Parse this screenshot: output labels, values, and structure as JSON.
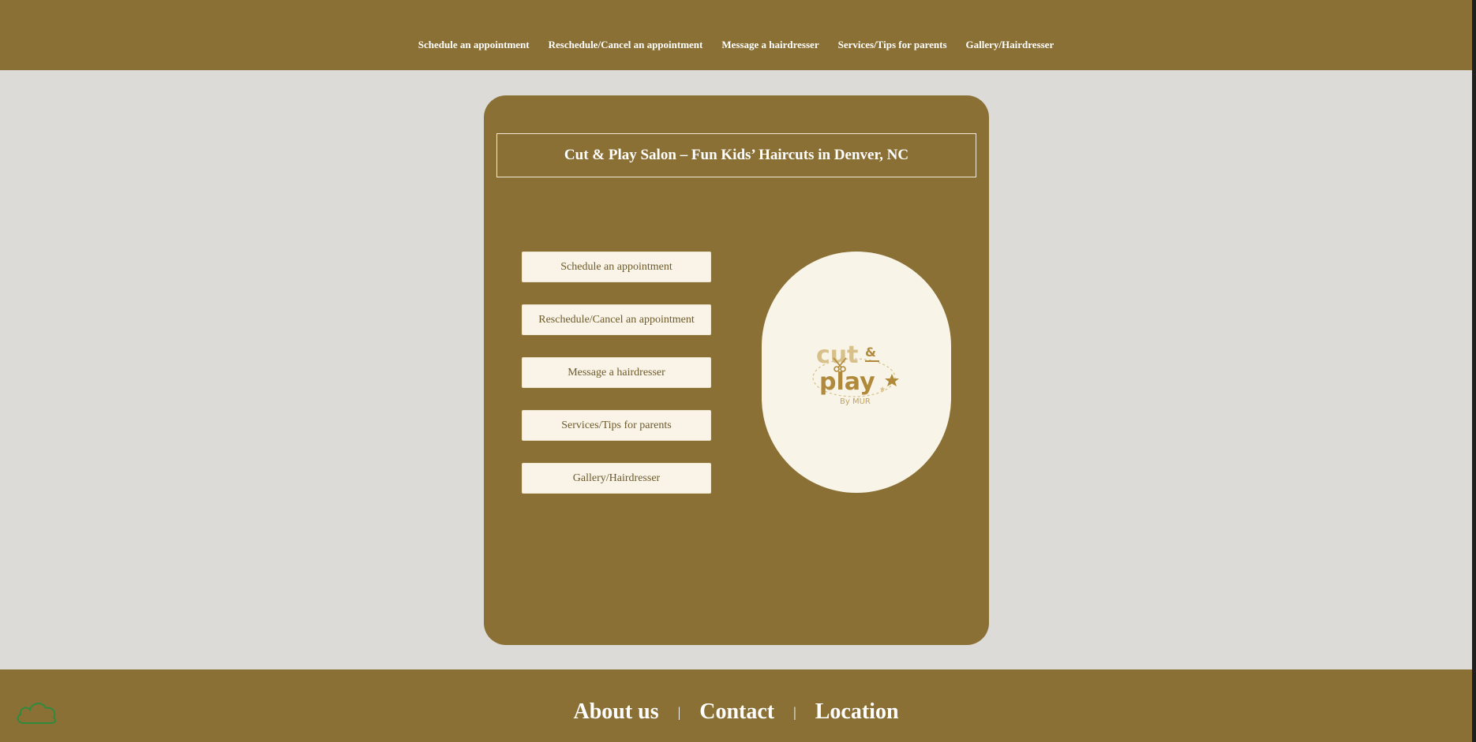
{
  "header": {
    "nav": [
      "Schedule an appointment",
      "Reschedule/Cancel an appointment",
      "Message a hairdresser",
      "Services/Tips for parents",
      "Gallery/Hairdresser"
    ]
  },
  "main": {
    "title": "Cut & Play Salon – Fun Kids’ Haircuts in Denver, NC",
    "buttons": [
      "Schedule an appointment",
      "Reschedule/Cancel an appointment",
      "Message a hairdresser",
      "Services/Tips for parents",
      "Gallery/Hairdresser"
    ],
    "logo": {
      "line1": "cut",
      "amp": "&",
      "line2": "play",
      "byline": "By MUR",
      "icon": "scissors-star-logo"
    }
  },
  "footer": {
    "links": [
      "About us",
      "Contact",
      "Location"
    ],
    "separator": "|"
  },
  "colors": {
    "brand_brown": "#8a7035",
    "background": "#dcdbd8",
    "cream": "#f9f4e7",
    "logo_gold": "#c9a452",
    "logo_light": "#d8c08a",
    "cloud_green": "#2e8b3e"
  },
  "icons": {
    "floating": "cloud-icon"
  }
}
